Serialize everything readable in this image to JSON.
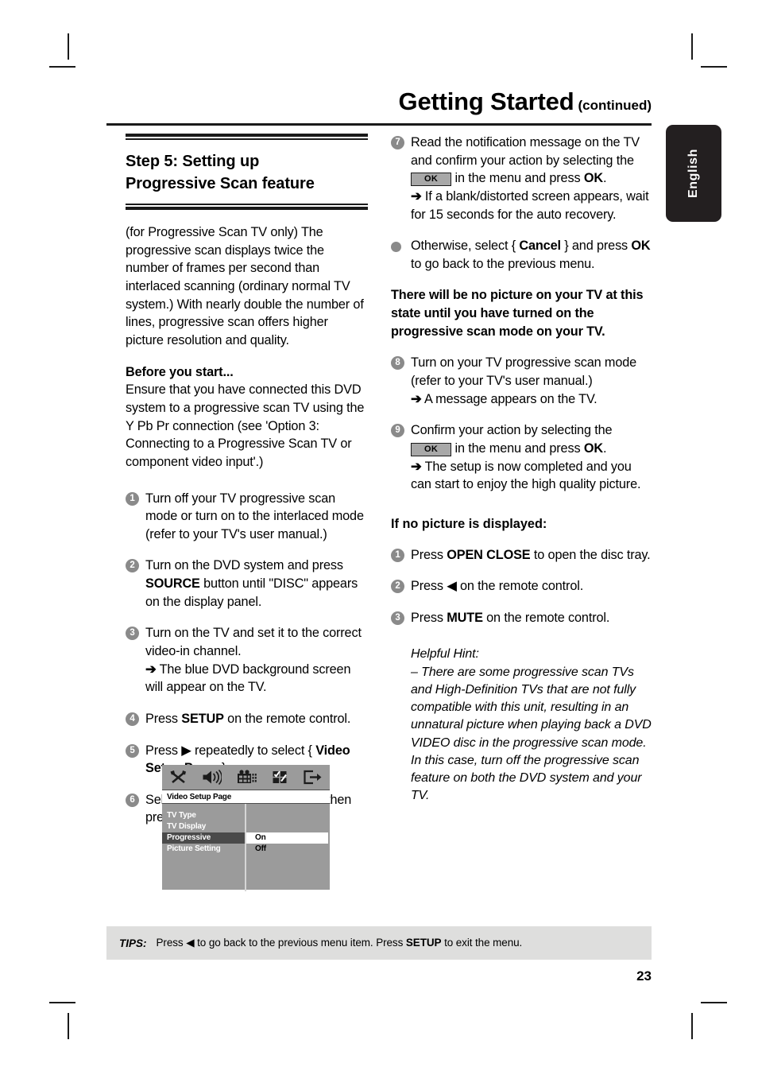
{
  "header": {
    "title": "Getting Started",
    "continued": "(continued)"
  },
  "language_tab": {
    "label": "English"
  },
  "left_column": {
    "section_title": "Step 5:  Setting up\nProgressive Scan feature",
    "section_title_line1": "Step 5:  Setting up",
    "section_title_line2": "Progressive Scan feature",
    "intro": "(for Progressive Scan TV only)\nThe progressive scan displays twice the number of frames per second than interlaced scanning (ordinary normal TV system.) With nearly double the number of lines, progressive scan offers higher picture resolution and quality.",
    "before_you_start_head": "Before you start...",
    "before_you_start_body": "Ensure that you have connected this DVD system to a progressive scan TV using the Y Pb Pr connection (see 'Option 3: Connecting to a Progressive Scan TV or component video input'.)",
    "steps": [
      {
        "num": "1",
        "text": "Turn off your TV progressive scan mode or turn on to the interlaced mode (refer to your TV's user manual.)"
      },
      {
        "num": "2",
        "text": "Turn on the DVD system and press SOURCE button until \"DISC\" appears on the display panel."
      },
      {
        "num": "3",
        "text": "Turn on the TV and set it to the correct video-in channel."
      },
      {
        "num": "3b",
        "text": "The blue DVD background screen will appear on the TV."
      },
      {
        "num": "4",
        "text": "Press SETUP on the remote control."
      },
      {
        "num": "5",
        "text": "Press  repeatedly to select { Video Setup Page. }"
      },
      {
        "num": "6",
        "text": "Select { Progressive } > { On, } then press OK to confirm."
      }
    ]
  },
  "osd": {
    "icons": [
      "tools-icon",
      "speaker-icon",
      "film-icon",
      "preference-icon",
      "exit-icon"
    ],
    "title": "Video Setup Page",
    "menu_items": [
      "TV Type",
      "TV Display",
      "Progressive",
      "Picture Setting"
    ],
    "selected_item": "Progressive",
    "values": [
      "On",
      "Off"
    ],
    "selected_value": "On"
  },
  "right_column": {
    "steps": [
      {
        "num": "7",
        "text": "Read the notification message on the TV and confirm your action by selecting the"
      },
      {
        "num": "7b",
        "text": "in the menu and press OK."
      },
      {
        "num": "7c",
        "text": "If a blank/distorted screen appears, wait for 15 seconds for the auto recovery."
      },
      {
        "num": "bullet",
        "text": "Otherwise, select { Cancel } and press OK to go back to the previous menu."
      },
      {
        "num": "8",
        "text": "Turn on your TV progressive scan mode (refer to your TV's user manual.)"
      },
      {
        "num": "8b",
        "text": "A message appears on the TV."
      },
      {
        "num": "9",
        "text": "Confirm your action by selecting the"
      },
      {
        "num": "9b",
        "text": "in the menu and press OK."
      },
      {
        "num": "9c",
        "text": "The setup is now completed and you can start to enjoy the high quality picture."
      }
    ],
    "notice": "There will be no picture on your TV at this state until you have turned on the progressive scan mode on your TV.",
    "no_picture_head": "If no picture is displayed:",
    "no_picture_steps": [
      {
        "num": "1",
        "text": "Press OPEN CLOSE to open the disc tray."
      },
      {
        "num": "2",
        "text": "Press  on the remote control."
      },
      {
        "num": "3",
        "text": "Press MUTE on the remote control."
      }
    ],
    "hint_title": "Helpful Hint:",
    "hint_body": "– There are some progressive scan TVs and High-Definition TVs that are not fully compatible with this unit, resulting in an unnatural picture when playing back a DVD VIDEO disc in the progressive scan mode. In this case, turn off the progressive scan feature on both the DVD system and your TV."
  },
  "footer": {
    "tips_label": "TIPS:",
    "tips_text_part1": "Press",
    "tips_text_part2": "to go back to the previous menu item.  Press",
    "tips_setup": "SETUP",
    "tips_text_part3": "to exit the menu.",
    "page_number": "23"
  },
  "labels": {
    "ok_chip": "OK",
    "source": "SOURCE",
    "disc": "\"DISC\"",
    "setup": "SETUP",
    "video_setup_page": "Video Setup Page",
    "progressive": "Progressive",
    "on": "On,",
    "ok": "OK",
    "cancel": "Cancel",
    "open_close": "OPEN CLOSE",
    "mute": "MUTE"
  }
}
